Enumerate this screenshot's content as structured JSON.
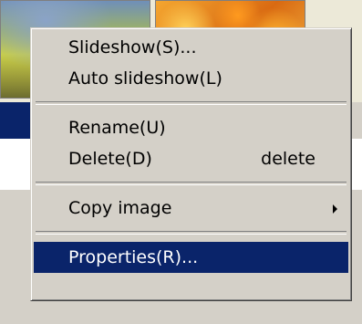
{
  "context_menu": {
    "items": [
      {
        "label": "Slideshow(S)..."
      },
      {
        "label": "Auto slideshow(L)"
      },
      {
        "label": "Rename(U)"
      },
      {
        "label": "Delete(D)",
        "shortcut": "delete"
      },
      {
        "label": "Copy image",
        "submenu_icon": "chevron-right-icon"
      },
      {
        "label": "Properties(R)...",
        "selected": true
      }
    ]
  },
  "colors": {
    "menu_background": "#d4d0c8",
    "selection": "#0a246a",
    "selection_text": "#ffffff"
  }
}
